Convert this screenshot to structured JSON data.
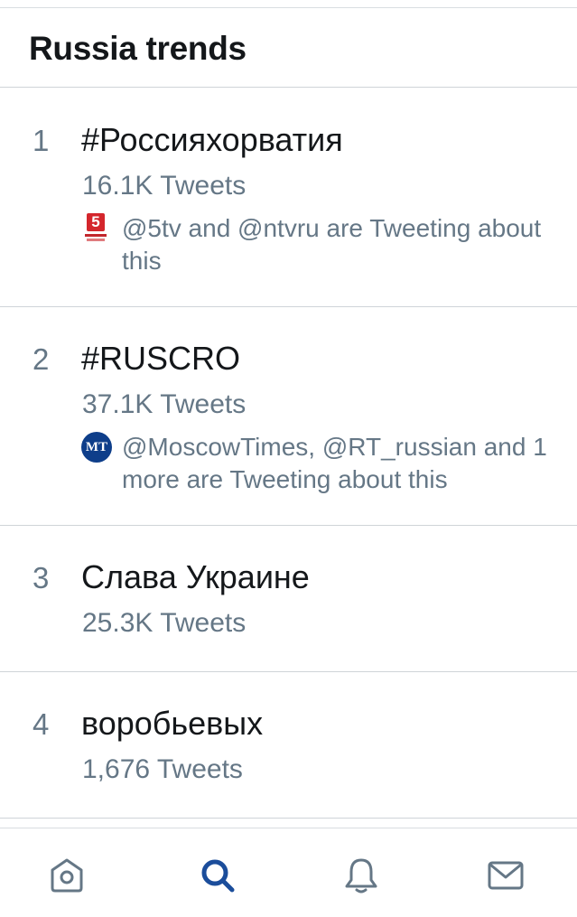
{
  "header": {
    "title": "Russia trends"
  },
  "trends": [
    {
      "rank": "1",
      "name": "#Россияхорватия",
      "count": "16.1K Tweets",
      "context": "@5tv and @ntvru are Tweeting about this",
      "avatar_icon": "5tv-logo-icon",
      "avatar_text": "5"
    },
    {
      "rank": "2",
      "name": "#RUSCRO",
      "count": "37.1K Tweets",
      "context": "@MoscowTimes, @RT_russian and 1 more are Tweeting about this",
      "avatar_icon": "moscow-times-logo-icon",
      "avatar_text": "MT"
    },
    {
      "rank": "3",
      "name": "Слава Украине",
      "count": "25.3K Tweets"
    },
    {
      "rank": "4",
      "name": "воробьевых",
      "count": "1,676 Tweets"
    }
  ],
  "tabbar": {
    "items": [
      {
        "icon": "home-icon",
        "active": false
      },
      {
        "icon": "search-icon",
        "active": true
      },
      {
        "icon": "bell-icon",
        "active": false
      },
      {
        "icon": "mail-icon",
        "active": false
      }
    ],
    "active_color": "#1b4d9b",
    "inactive_color": "#657786"
  }
}
